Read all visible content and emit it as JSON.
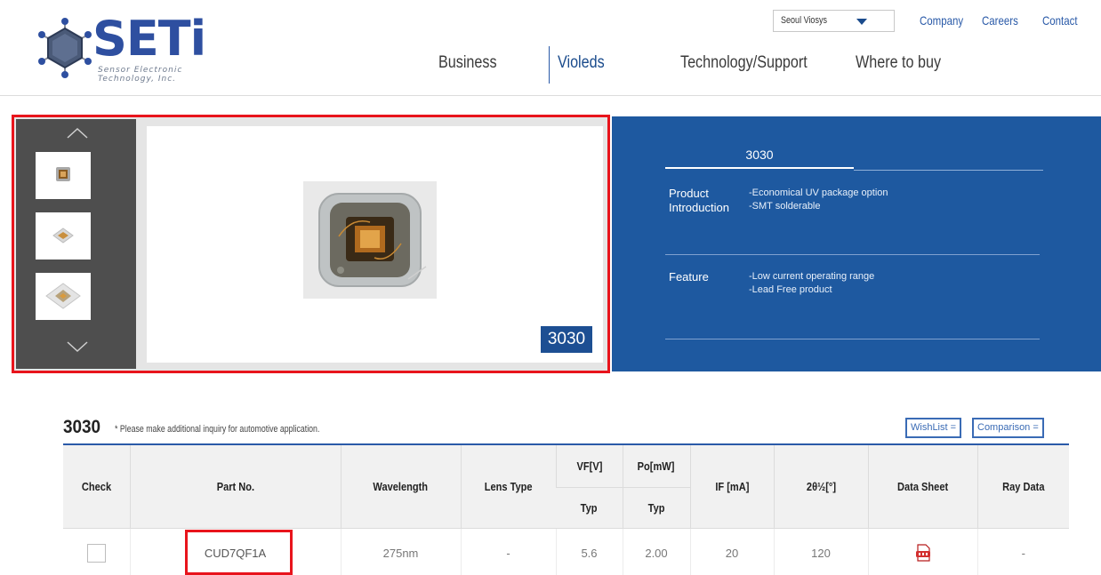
{
  "header": {
    "logo": {
      "word": "SETi",
      "sub1": "Sensor Electronic",
      "sub2": "Technology, Inc."
    },
    "region_select": {
      "value": "Seoul Viosys"
    },
    "utility_links": [
      "Company",
      "Careers",
      "Contact"
    ],
    "nav": [
      "Business",
      "Violeds",
      "Technology/Support",
      "Where to buy"
    ],
    "active_nav": "Violeds"
  },
  "hero": {
    "badge": "3030",
    "tab_title": "3030",
    "product_intro_label": "Product Introduction",
    "product_intro_lines": [
      "-Economical UV package option",
      "-SMT solderable"
    ],
    "feature_label": "Feature",
    "feature_lines": [
      "-Low current operating range",
      "-Lead Free product"
    ],
    "colors": {
      "panel_blue": "#1e59a0",
      "highlight_red": "#e8141c"
    }
  },
  "section": {
    "title": "3030",
    "note": "* Please make additional inquiry for automotive application.",
    "wishlist_label": "WishList  =",
    "comparison_label": "Comparison  ="
  },
  "table": {
    "headers": {
      "check": "Check",
      "part_no": "Part No.",
      "wavelength": "Wavelength",
      "lens_type": "Lens Type",
      "vf": "VF[V]",
      "po": "Po[mW]",
      "typ": "Typ",
      "if": "IF [mA]",
      "angle": "2θ½[°]",
      "data_sheet": "Data Sheet",
      "ray_data": "Ray Data"
    },
    "rows": [
      {
        "part_no": "CUD7QF1A",
        "wavelength": "275nm",
        "lens_type": "-",
        "vf_typ": "5.6",
        "po_typ": "2.00",
        "if": "20",
        "angle": "120",
        "data_sheet_icon": "pdf-icon",
        "ray_data": "-"
      }
    ]
  }
}
